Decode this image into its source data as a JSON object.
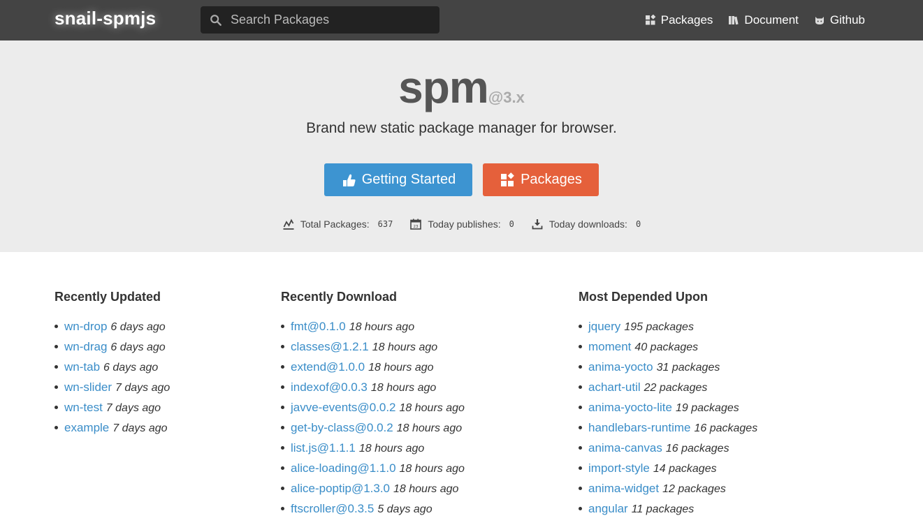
{
  "navbar": {
    "logo": "snail-spmjs",
    "search_placeholder": "Search Packages",
    "links": [
      {
        "label": "Packages",
        "icon": "packages-icon"
      },
      {
        "label": "Document",
        "icon": "books-icon"
      },
      {
        "label": "Github",
        "icon": "github-icon"
      }
    ]
  },
  "hero": {
    "title": "spm",
    "version": "@3.x",
    "tagline": "Brand new static package manager for browser.",
    "buttons": {
      "getting_started": "Getting Started",
      "packages": "Packages"
    },
    "stats": {
      "total_label": "Total Packages:",
      "total_value": "637",
      "publishes_label": "Today publishes:",
      "publishes_value": "0",
      "downloads_label": "Today downloads:",
      "downloads_value": "0"
    }
  },
  "colors": {
    "navbar_bg": "#444444",
    "hero_bg": "#ececec",
    "link": "#3a8dc8",
    "btn_start": "#3d94d1",
    "btn_packages": "#e5603b"
  },
  "recently_updated": {
    "title": "Recently Updated",
    "items": [
      {
        "name": "wn-drop",
        "meta": "6 days ago"
      },
      {
        "name": "wn-drag",
        "meta": "6 days ago"
      },
      {
        "name": "wn-tab",
        "meta": "6 days ago"
      },
      {
        "name": "wn-slider",
        "meta": "7 days ago"
      },
      {
        "name": "wn-test",
        "meta": "7 days ago"
      },
      {
        "name": "example",
        "meta": "7 days ago"
      }
    ]
  },
  "recently_download": {
    "title": "Recently Download",
    "items": [
      {
        "name": "fmt@0.1.0",
        "meta": "18 hours ago"
      },
      {
        "name": "classes@1.2.1",
        "meta": "18 hours ago"
      },
      {
        "name": "extend@1.0.0",
        "meta": "18 hours ago"
      },
      {
        "name": "indexof@0.0.3",
        "meta": "18 hours ago"
      },
      {
        "name": "javve-events@0.0.2",
        "meta": "18 hours ago"
      },
      {
        "name": "get-by-class@0.0.2",
        "meta": "18 hours ago"
      },
      {
        "name": "list.js@1.1.1",
        "meta": "18 hours ago"
      },
      {
        "name": "alice-loading@1.1.0",
        "meta": "18 hours ago"
      },
      {
        "name": "alice-poptip@1.3.0",
        "meta": "18 hours ago"
      },
      {
        "name": "ftscroller@0.3.5",
        "meta": "5 days ago"
      }
    ]
  },
  "most_depended": {
    "title": "Most Depended Upon",
    "items": [
      {
        "name": "jquery",
        "meta": "195 packages"
      },
      {
        "name": "moment",
        "meta": "40 packages"
      },
      {
        "name": "anima-yocto",
        "meta": "31 packages"
      },
      {
        "name": "achart-util",
        "meta": "22 packages"
      },
      {
        "name": "anima-yocto-lite",
        "meta": "19 packages"
      },
      {
        "name": "handlebars-runtime",
        "meta": "16 packages"
      },
      {
        "name": "anima-canvas",
        "meta": "16 packages"
      },
      {
        "name": "import-style",
        "meta": "14 packages"
      },
      {
        "name": "anima-widget",
        "meta": "12 packages"
      },
      {
        "name": "angular",
        "meta": "11 packages"
      }
    ]
  }
}
